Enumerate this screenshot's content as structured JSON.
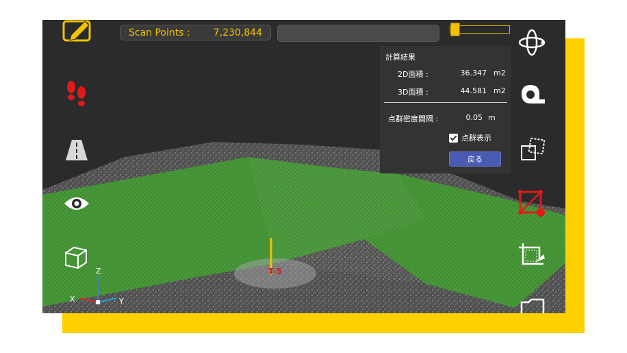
{
  "scan_points": {
    "label": "Scan Points :",
    "value": "7,230,844"
  },
  "panel": {
    "title": "計算結果",
    "area_2d": {
      "label": "2D面積 :",
      "value": "36.347",
      "unit": "m2"
    },
    "area_3d": {
      "label": "3D面積 :",
      "value": "44.581",
      "unit": "m2"
    },
    "density": {
      "label": "点群密度間隔 :",
      "value": "0.05",
      "unit": "m"
    },
    "show_points": {
      "label": "点群表示",
      "checked": true
    },
    "back_button": "戻る"
  },
  "marker": {
    "label": "T-5"
  },
  "axes": {
    "z": "Z",
    "x": "X",
    "y": "Y"
  },
  "slider": {
    "level": 0.02
  },
  "left_toolbar": [
    "edit-icon",
    "footsteps-icon",
    "road-icon",
    "eye-icon",
    "cube-icon"
  ],
  "right_toolbar": [
    "orbit-icon",
    "tape-measure-icon",
    "transform-icon",
    "area-measure-icon",
    "crop-icon",
    "folder-icon"
  ],
  "colors": {
    "accent": "#f2c200",
    "frame": "#ffd000",
    "mesh": "#3c9a2a",
    "area_icon": "#e01b1b",
    "button": "#4a5bb4"
  }
}
